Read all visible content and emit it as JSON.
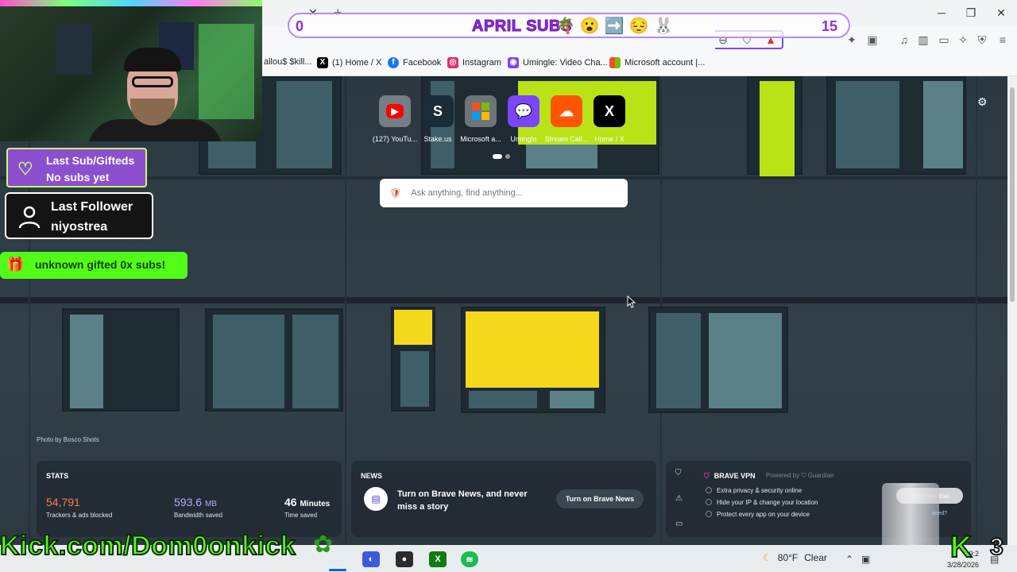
{
  "stream_goal": {
    "start": "0",
    "title": "APRIL SUBS",
    "emojis": "🌴😮➡️😔🐰",
    "end": "15"
  },
  "browser": {
    "tab_close": "✕",
    "tab_new": "+",
    "window_controls": {
      "minimize": "─",
      "maximize": "❐",
      "close": "✕"
    },
    "bookmarks": [
      {
        "label": "allou$ $kill...",
        "icon": "bookmark-icon",
        "color": "#e04b4b"
      },
      {
        "label": "(1) Home / X",
        "icon": "x-icon",
        "color": "#000000"
      },
      {
        "label": "Facebook",
        "icon": "facebook-icon",
        "color": "#1877f2"
      },
      {
        "label": "Instagram",
        "icon": "instagram-icon",
        "color": "#e1306c"
      },
      {
        "label": "Umingle: Video Cha...",
        "icon": "umingle-icon",
        "color": "#7b46ff"
      },
      {
        "label": "Microsoft account |...",
        "icon": "microsoft-icon",
        "color": "#f25022"
      }
    ]
  },
  "overlays": {
    "last_sub_title": "Last Sub/Gifteds",
    "last_sub_value": "No subs yet",
    "last_follower_title": "Last Follower",
    "last_follower_value": "niyostrea",
    "gift_text": "unknown gifted 0x subs!",
    "kick_banner": "Kick.com/Dom0onkick",
    "kick_logo": "K",
    "kick_count": "3"
  },
  "new_tab": {
    "top_sites": [
      {
        "label": "(127) YouTu...",
        "glyph": "▶",
        "icon": "youtube-icon",
        "color": "#ff0000"
      },
      {
        "label": "Stake.us",
        "glyph": "S",
        "icon": "stake-icon",
        "color": "#1a2c38"
      },
      {
        "label": "Microsoft a...",
        "glyph": "▦",
        "icon": "microsoft-icon",
        "color": "#f25022"
      },
      {
        "label": "Umingle",
        "glyph": "💬",
        "icon": "umingle-icon",
        "color": "#7b46ff"
      },
      {
        "label": "Stream Call...",
        "glyph": "☁",
        "icon": "soundcloud-icon",
        "color": "#ff5500"
      },
      {
        "label": "Home / X",
        "glyph": "𝕏",
        "icon": "x-icon",
        "color": "#000000"
      }
    ],
    "search_placeholder": "Ask anything, find anything...",
    "photo_credit": "Photo by Bosco Shots",
    "stats": {
      "heading": "STATS",
      "trackers_value": "54,791",
      "trackers_label": "Trackers & ads blocked",
      "bandwidth_value": "593.6",
      "bandwidth_unit": "MB",
      "bandwidth_label": "Bandwidth saved",
      "time_value": "46",
      "time_unit": "Minutes",
      "time_label": "Time saved",
      "colors": {
        "trackers": "#ff7a52",
        "bandwidth": "#b9a7ff",
        "time": "#ffffff"
      }
    },
    "news": {
      "heading": "NEWS",
      "text": "Turn on Brave News, and never miss a story",
      "button": "Turn on Brave News"
    },
    "vpn": {
      "title": "BRAVE VPN",
      "powered_by": "Powered by ⛉ Guardian",
      "features": [
        "Extra privacy & security online",
        "Hide your IP & change your location",
        "Protect every app on your device"
      ],
      "button": "Start free trial",
      "already": "ased?"
    }
  },
  "taskbar": {
    "weather_temp": "80°F",
    "weather_text": "Clear",
    "time": "9:2",
    "date": "3/28/2026"
  }
}
